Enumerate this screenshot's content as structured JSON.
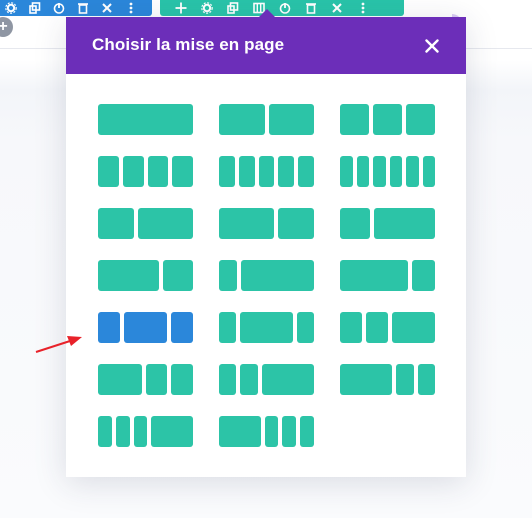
{
  "modal": {
    "title": "Choisir la mise en page",
    "close_icon": "close-icon"
  },
  "colors": {
    "header": "#6c2eb9",
    "layout_column": "#2cc4a7",
    "layout_selected": "#2b87da",
    "row_toolbar": "#2b87da",
    "module_toolbar": "#29c4a9",
    "arrow": "#e8222a"
  },
  "row_toolbar": {
    "icons": [
      "gear-icon",
      "duplicate-icon",
      "power-icon",
      "trash-icon",
      "close-icon",
      "more-icon"
    ]
  },
  "module_toolbar": {
    "icons": [
      "move-icon",
      "gear-icon",
      "duplicate-icon",
      "columns-icon",
      "power-icon",
      "trash-icon",
      "close-icon",
      "more-icon"
    ]
  },
  "add_button": {
    "label": "+"
  },
  "layouts": [
    {
      "id": "1",
      "ratios": [
        1
      ]
    },
    {
      "id": "1_2,1_2",
      "ratios": [
        1,
        1
      ]
    },
    {
      "id": "1_3,1_3,1_3",
      "ratios": [
        1,
        1,
        1
      ]
    },
    {
      "id": "1_4x4",
      "ratios": [
        1,
        1,
        1,
        1
      ]
    },
    {
      "id": "1_5x5",
      "ratios": [
        1,
        1,
        1,
        1,
        1
      ]
    },
    {
      "id": "1_6x6",
      "ratios": [
        1,
        1,
        1,
        1,
        1,
        1
      ]
    },
    {
      "id": "2_5,3_5",
      "ratios": [
        2,
        3
      ]
    },
    {
      "id": "3_5,2_5",
      "ratios": [
        3,
        2
      ]
    },
    {
      "id": "1_3,2_3",
      "ratios": [
        1,
        2
      ]
    },
    {
      "id": "2_3,1_3",
      "ratios": [
        2,
        1
      ]
    },
    {
      "id": "1_4,3_4",
      "ratios": [
        1,
        4
      ]
    },
    {
      "id": "3_4,1_4",
      "ratios": [
        3,
        1
      ]
    },
    {
      "id": "1_4,1_2,1_4",
      "ratios": [
        1,
        2,
        1
      ],
      "selected": true
    },
    {
      "id": "1_5,3_5,1_5",
      "ratios": [
        1,
        3,
        1
      ]
    },
    {
      "id": "1_4,1_4,1_2",
      "ratios": [
        1,
        1,
        2
      ]
    },
    {
      "id": "1_2,1_4,1_4",
      "ratios": [
        2,
        1,
        1
      ]
    },
    {
      "id": "1_5,1_5,3_5",
      "ratios": [
        1,
        1,
        3
      ]
    },
    {
      "id": "3_5,1_5,1_5",
      "ratios": [
        3,
        1,
        1
      ]
    },
    {
      "id": "1_6,1_6,1_6,1_2",
      "ratios": [
        1,
        1,
        1,
        3
      ]
    },
    {
      "id": "1_2,1_6,1_6,1_6",
      "ratios": [
        3,
        1,
        1,
        1
      ]
    }
  ]
}
